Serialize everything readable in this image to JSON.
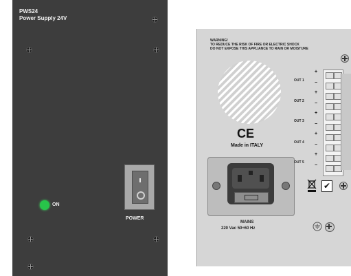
{
  "front_panel": {
    "model": "PWS24",
    "name": "Power Supply 24V",
    "led_label": "ON",
    "switch_label": "POWER",
    "led_color": "#28c44a",
    "panel_color": "#3d3d3d"
  },
  "rear_panel": {
    "warning_title": "WARNING!",
    "warning_line1": "TO REDUCE THE RISK OF FIRE OR ELECTRIC SHOCK",
    "warning_line2": "DO NOT EXPOSE THIS APPLIANCE TO RAIN OR MOISTURE",
    "ce_mark": "CE",
    "made_in": "Made in ITALY",
    "outputs": [
      "OUT 1",
      "OUT 2",
      "OUT 3",
      "OUT 4",
      "OUT 5"
    ],
    "mains_label": "MAINS",
    "mains_rating": "220 Vac 50÷60 Hz",
    "plus_sign": "+",
    "minus_sign": "−",
    "check_mark": "✔",
    "panel_color": "#d6d6d6"
  }
}
